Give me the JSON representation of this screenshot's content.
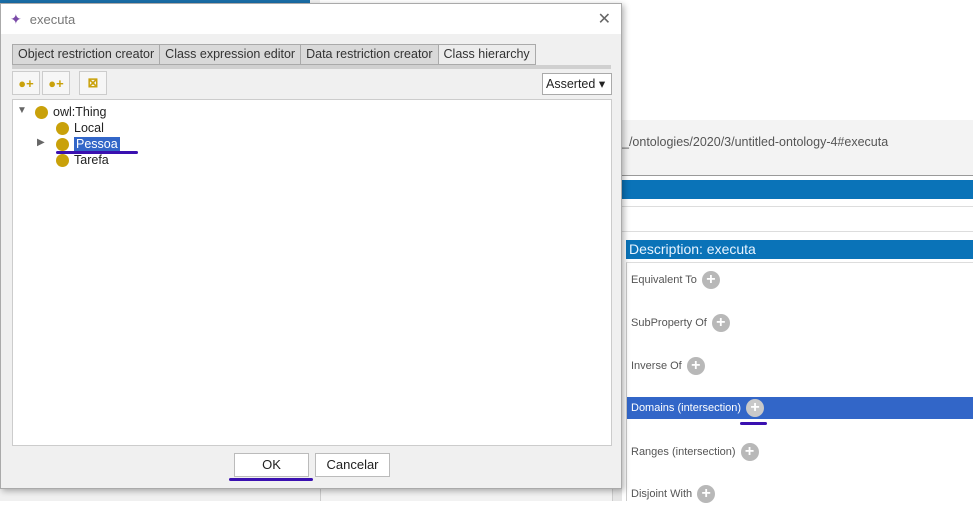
{
  "dialog": {
    "title": "executa",
    "tabs": [
      "Object restriction creator",
      "Class expression editor",
      "Data restriction creator",
      "Class hierarchy"
    ],
    "active_tab": "Class hierarchy",
    "toolbar": {
      "add_subclass_icon": "add-subclass-icon",
      "add_sibling_icon": "add-sibling-icon",
      "delete_icon": "delete-class-icon",
      "mode": "Asserted"
    },
    "tree": {
      "root": "owl:Thing",
      "children": [
        "Local",
        "Pessoa",
        "Tarefa"
      ],
      "selected": "Pessoa"
    },
    "ok": "OK",
    "cancel": "Cancelar"
  },
  "background": {
    "iri": "_/ontologies/2020/3/untitled-ontology-4#executa",
    "description_title": "Description: executa",
    "sections": [
      "Equivalent To",
      "SubProperty Of",
      "Inverse Of",
      "Domains (intersection)",
      "Ranges (intersection)",
      "Disjoint With"
    ],
    "selected_section": "Domains (intersection)",
    "plus": "+"
  },
  "colors": {
    "accent": "#0a73b8",
    "selection": "#3266c8",
    "class_icon": "#c9a10a",
    "annotation_underline": "#3a10b0"
  }
}
